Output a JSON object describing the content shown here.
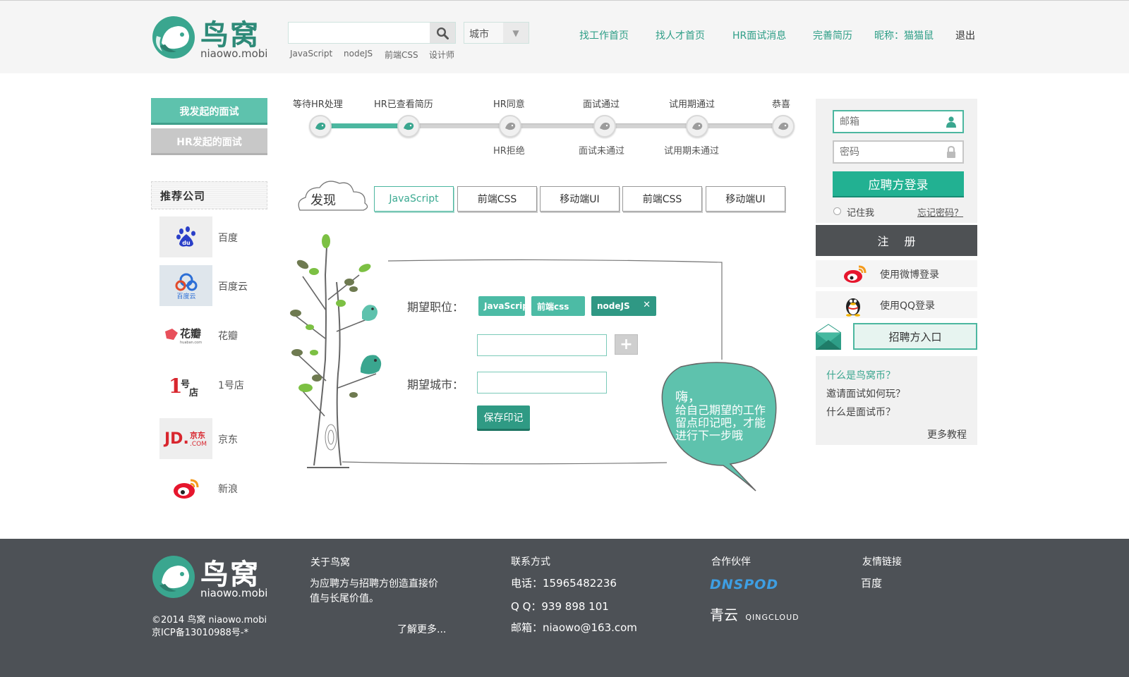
{
  "brand": {
    "name": "鸟窝",
    "domain": "niaowo.mobi",
    "primary_color": "#4cb7a0",
    "dark_color": "#2f9884"
  },
  "search": {
    "value": "",
    "placeholder": "",
    "city_label": "城市",
    "hot_tags": [
      "JavaScript",
      "nodeJS",
      "前端CSS",
      "设计师"
    ]
  },
  "nav": {
    "links": [
      "找工作首页",
      "找人才首页",
      "HR面试消息",
      "完善简历",
      "昵称：猫猫鼠"
    ],
    "logout": "退出"
  },
  "sidebar": {
    "tabs": [
      "我发起的面试",
      "HR发起的面试"
    ],
    "recommend_heading": "推荐公司",
    "companies": [
      {
        "name": "百度",
        "logo_text": "du"
      },
      {
        "name": "百度云",
        "logo_text": "百度云"
      },
      {
        "name": "花瓣",
        "logo_text": "花瓣",
        "logo_sub": "huaban.com"
      },
      {
        "name": "1号店",
        "logo_text": "1号店"
      },
      {
        "name": "京东",
        "logo_text": "JD.京东",
        "logo_sub": ".COM"
      },
      {
        "name": "新浪",
        "logo_text": ""
      }
    ]
  },
  "progress": {
    "steps_top": [
      "等待HR处理",
      "HR已查看简历",
      "HR同意",
      "面试通过",
      "试用期通过",
      "恭喜"
    ],
    "steps_bottom": [
      "HR拒绝",
      "面试未通过",
      "试用期未通过"
    ],
    "completed_steps": 2
  },
  "discover": {
    "label": "发现",
    "tabs": [
      "JavaScript",
      "前端CSS",
      "移动端UI",
      "前端CSS",
      "移动端UI"
    ],
    "active_index": 0
  },
  "form": {
    "position_label": "期望职位：",
    "position_tags": [
      "JavaScript",
      "前端css",
      "nodeJS"
    ],
    "tag_remove": "✕",
    "position_input": "",
    "add_symbol": "+",
    "city_label": "期望城市：",
    "city_input": "",
    "save_label": "保存印记",
    "bubble": [
      "嗨，",
      "给自己期望的工作",
      "留点印记吧，才能",
      "进行下一步哦"
    ]
  },
  "login": {
    "email_placeholder": "邮箱",
    "password_placeholder": "密码",
    "applicant_login": "应聘方登录",
    "remember": "记住我",
    "forgot": "忘记密码？",
    "register": "注册",
    "weibo_login": "使用微博登录",
    "qq_login": "使用QQ登录",
    "recruiter_entry": "招聘方入口"
  },
  "faq": {
    "items": [
      "什么是鸟窝币？",
      "邀请面试如何玩？",
      "什么是面试币？"
    ],
    "more": "更多教程"
  },
  "footer": {
    "copyright": "©2014 鸟窝 niaowo.mobi",
    "icp": "京ICP备13010988号-*",
    "about": {
      "title": "关于鸟窝",
      "text": [
        "为应聘方与招聘方创造直接价",
        "值与长尾价值。"
      ],
      "more": "了解更多..."
    },
    "contact": {
      "title": "联系方式",
      "phone": "电话：15965482236",
      "qq": "Q Q：939 898 101",
      "email": "邮箱：niaowo@163.com"
    },
    "partners": {
      "title": "合作伙伴",
      "items": [
        "DNSPOD",
        "青云",
        "QINGCLOUD"
      ]
    },
    "friends": {
      "title": "友情链接",
      "items": [
        "百度"
      ]
    }
  }
}
